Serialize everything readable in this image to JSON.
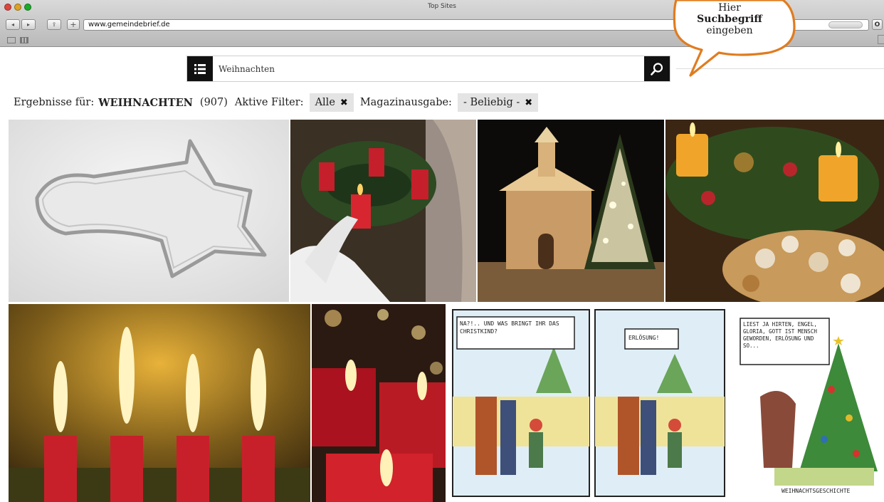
{
  "browser": {
    "window_title": "Top Sites",
    "url": "www.gemeindebrief.de",
    "right_button_label": "O"
  },
  "search": {
    "value": "Weihnachten",
    "button_icon": "search-icon",
    "menu_icon": "list-menu-icon"
  },
  "results": {
    "prefix": "Ergebnisse für:",
    "term": "WEIHNACHTEN",
    "count": "(907)",
    "active_filters_label": "Aktive Filter:",
    "filters": [
      {
        "label": "Alle",
        "remove_icon": "close-icon"
      }
    ],
    "magazine_label": "Magazinausgabe:",
    "magazine_filter": {
      "label": "- Beliebig -",
      "remove_icon": "close-icon"
    }
  },
  "callout": {
    "line1": "Hier",
    "line2": "Suchbegriff",
    "line3": "eingeben",
    "fill": "#ffffff",
    "stroke": "#e07c1f"
  },
  "images": [
    {
      "name": "star-cookie-cutter"
    },
    {
      "name": "advent-wreath-child"
    },
    {
      "name": "chapel-night-tree"
    },
    {
      "name": "advent-wreath-cookies"
    },
    {
      "name": "four-red-candles"
    },
    {
      "name": "red-candles-bokeh"
    },
    {
      "name": "cartoon-christmas-street"
    },
    {
      "name": "cartoon-christmas-tree"
    }
  ],
  "cartoon_texts": [
    "NA?!.. UND WAS BRINGT IHR DAS CHRISTKIND?",
    "ERLÖSUNG!",
    "LIEST JA HIRTEN, ENGEL, GLORIA, GOTT IST MENSCH GEWORDEN, ERLÖSUNG UND SO...",
    "WEIHNACHTSGESCHICHTE"
  ]
}
